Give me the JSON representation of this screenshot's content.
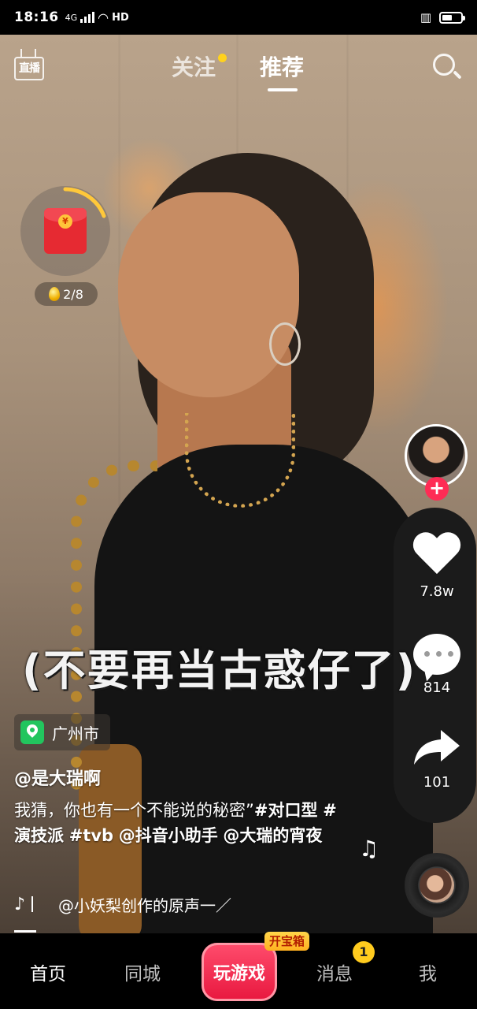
{
  "status_bar": {
    "time": "18:16",
    "network": "4G",
    "hd": "HD"
  },
  "top_nav": {
    "live_label": "直播",
    "tabs": [
      {
        "label": "关注",
        "has_dot": true
      },
      {
        "label": "推荐",
        "active": true
      }
    ]
  },
  "red_packet": {
    "symbol": "¥",
    "coins": "2/8"
  },
  "video": {
    "subtitle": "(不要再当古惑仔了)"
  },
  "right_rail": {
    "likes": "7.8w",
    "comments": "814",
    "shares": "101"
  },
  "location": "广州市",
  "author": "@是大瑞啊",
  "description": {
    "text": "我猜，你也有一个不能说的秘密”",
    "tags": [
      "#对口型",
      "#演技派",
      "#tvb",
      "@抖音小助手",
      "@大瑞的宵夜"
    ]
  },
  "music": {
    "song": "@小妖梨创作的原声一／"
  },
  "bottom_nav": {
    "home": "首页",
    "city": "同城",
    "game": "玩游戏",
    "game_tag": "开宝箱",
    "messages": "消息",
    "messages_badge": "1",
    "me": "我"
  },
  "colors": {
    "accent_red": "#fe2c55",
    "badge_yellow": "#ffcb1e",
    "location_green": "#22c55e"
  }
}
